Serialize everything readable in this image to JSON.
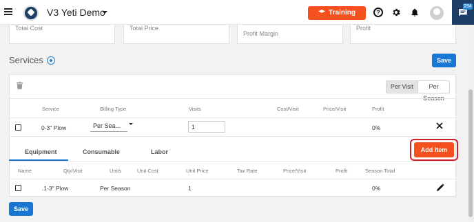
{
  "header": {
    "app_title": "V3 Yeti Demo",
    "training_label": "Training",
    "help_glyph": "?",
    "chat_badge": "294",
    "icons": [
      "menu-icon",
      "logo",
      "graduation-cap-icon",
      "help-icon",
      "gear-icon",
      "bell-icon",
      "avatar",
      "chat-icon"
    ],
    "colors": {
      "brand": "#1c3e66",
      "accent": "#f4511e",
      "primary": "#1976d2"
    }
  },
  "summary_cards": [
    {
      "label": "Total Cost"
    },
    {
      "label": "Total Price"
    },
    {
      "label": "Profit Margin"
    },
    {
      "label": "Profit"
    }
  ],
  "services": {
    "title": "Services",
    "save_label": "Save",
    "toggle": {
      "options": [
        "Per Visit",
        "Per Season"
      ],
      "selected": "Per Visit"
    },
    "columns": [
      "Service",
      "Billing Type",
      "Visits",
      "Cost/Visit",
      "Price/Visit",
      "Profit"
    ],
    "row": {
      "service": "0-3\" Plow",
      "billing_type": "Per Sea...",
      "visits": "1",
      "profit": "0%"
    },
    "tabs": [
      "Equipment",
      "Consumable",
      "Labor"
    ],
    "active_tab": "Equipment",
    "add_item_label": "Add Item",
    "item_columns": [
      "Name",
      "Qty/Visit",
      "Units",
      "Unit Cost",
      "Unit Price",
      "Tax Rate",
      "Price/Visit",
      "Profit",
      "Season Total"
    ],
    "item_row": {
      "qty": ".1-3\" Plow",
      "units": "Per Season",
      "unit_price": "1",
      "season_total": "0%"
    },
    "bottom_save_label": "Save"
  }
}
